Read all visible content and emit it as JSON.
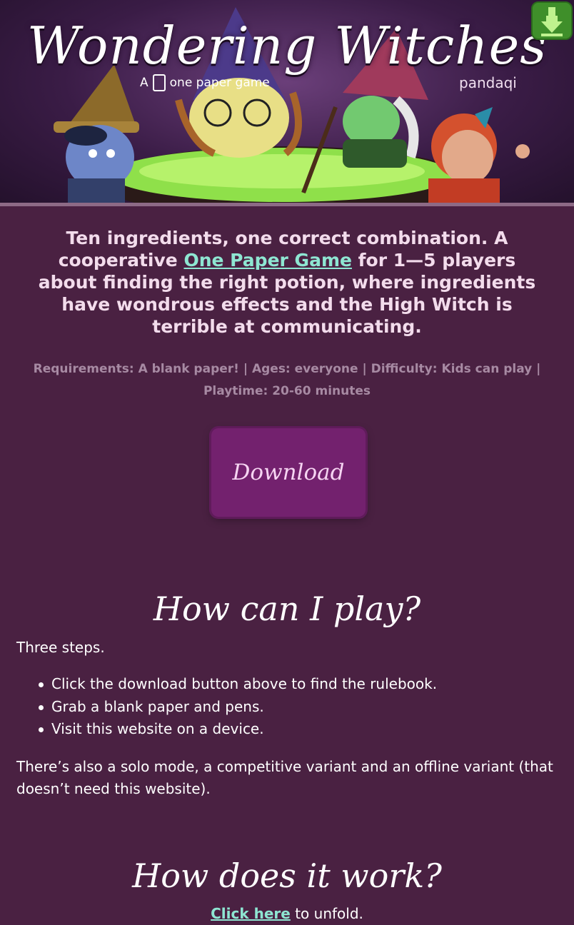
{
  "header": {
    "title": "Wondering Witches",
    "subtitle_prefix": "A",
    "subtitle_suffix": "one paper game",
    "brand": "pandaqi",
    "download_icon": "download-arrow-icon",
    "badge_color": "#3f8f2a"
  },
  "intro": {
    "text_before_link": "Ten ingredients, one correct combination. A cooperative ",
    "link_label": "One Paper Game",
    "text_after_link": " for 1—5 players about finding the right potion, where ingredients have wondrous effects and the High Witch is terrible at communicating."
  },
  "meta": "Requirements: A blank paper! | Ages: everyone | Difficulty: Kids can play | Playtime: 20-60 minutes",
  "download_button": {
    "label": "Download",
    "color": "#73216e"
  },
  "how_to_play": {
    "heading": "How can I play?",
    "intro": "Three steps.",
    "steps": [
      "Click the download button above to find the rulebook.",
      "Grab a blank paper and pens.",
      "Visit this website on a device."
    ],
    "extra": "There’s also a solo mode, a competitive variant and an offline variant (that doesn’t need this website)."
  },
  "how_it_works": {
    "heading": "How does it work?",
    "link_label": "Click here",
    "suffix": " to unfold."
  },
  "colors": {
    "background": "#4a2142",
    "link": "#8ee6d2",
    "intro_text": "#f3dcec",
    "meta_text": "#a78aa3"
  }
}
